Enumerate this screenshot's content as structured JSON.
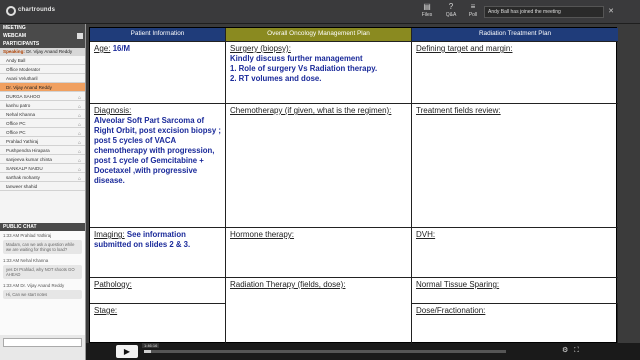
{
  "app": {
    "logo_text": "chartrounds",
    "toolbar": [
      {
        "label": "Files",
        "icon": "files-icon"
      },
      {
        "label": "Q&A",
        "icon": "qa-icon"
      },
      {
        "label": "Poll",
        "icon": "poll-icon"
      }
    ],
    "notification": "Andy Ball has joined the meeting"
  },
  "sidebar": {
    "meeting_header": "MEETING",
    "webcam_label": "WEBCAM",
    "participants_label": "PARTICIPANTS",
    "speaking_label": "Speaking:",
    "speaking_name": "Dr. Vijay Anand Reddy",
    "participants": [
      {
        "name": "Andy Ball",
        "highlight": false
      },
      {
        "name": "Office Moderator",
        "highlight": false
      },
      {
        "name": "Avani Velutharil",
        "highlight": false
      },
      {
        "name": "Dr. Vijay Anand Reddy",
        "highlight": true
      },
      {
        "name": "DURGA SAHOO",
        "highlight": false
      },
      {
        "name": "kanhu patro",
        "highlight": false
      },
      {
        "name": "Nehal  Khanna",
        "highlight": false
      },
      {
        "name": "Office PC",
        "highlight": false
      },
      {
        "name": "Office PC",
        "highlight": false
      },
      {
        "name": "Prahlad Yathiraj",
        "highlight": false
      },
      {
        "name": "Pushpendra Hirapara",
        "highlight": false
      },
      {
        "name": "sanjeeva kumar chinta",
        "highlight": false
      },
      {
        "name": "SANKALP NAIDU",
        "highlight": false
      },
      {
        "name": "sarthak mohanty",
        "highlight": false
      },
      {
        "name": "tanweer shahid",
        "highlight": false
      }
    ],
    "chat_header": "PUBLIC CHAT",
    "messages": [
      {
        "meta": "1:33 AM  Prahlad Yathiraj",
        "body": "Madam, can we ask a question while we are waiting for things to load?"
      },
      {
        "meta": "1:33 AM  Nehal  Khanna",
        "body": "yes Dr Prahlad, why NOT shoots GO AHEAD"
      },
      {
        "meta": "1:33 AM  Dr. Vijay Anand Reddy",
        "body": "Hi, Can we start notes"
      }
    ]
  },
  "slide": {
    "headers": [
      "Patient Information",
      "Overall Oncology Management Plan",
      "Radiation Treatment Plan"
    ],
    "age_label": "Age:",
    "age_value": "16/M",
    "surgery_label": "Surgery (biopsy):",
    "surgery_text": "Kindly discuss further management\n1. Role of surgery Vs Radiation therapy.\n2. RT volumes and dose.",
    "defining_target": "Defining target and margin:",
    "diagnosis_label": "Diagnosis:",
    "diagnosis_text": "Alveolar Soft Part Sarcoma of Right Orbit, post excision biopsy ; post 5 cycles of VACA chemotherapy with progression, post 1 cycle of Gemcitabine + Docetaxel ,with progressive disease.",
    "chemo_label": "Chemotherapy (if given, what is the regimen):",
    "treatment_fields": "Treatment fields review:",
    "imaging_label": "Imaging:",
    "imaging_text": "See information submitted on slides 2 & 3.",
    "hormone_label": "Hormone therapy:",
    "dvh_label": "DVH:",
    "pathology_label": "Pathology:",
    "radiation_label": "Radiation Therapy (fields, dose):",
    "normal_tissue": "Normal Tissue Sparing:",
    "stage_label": "Stage:",
    "dose_label": "Dose/Fractionation:"
  },
  "player": {
    "time": "1:46:16",
    "progress_fraction": 0.02
  }
}
